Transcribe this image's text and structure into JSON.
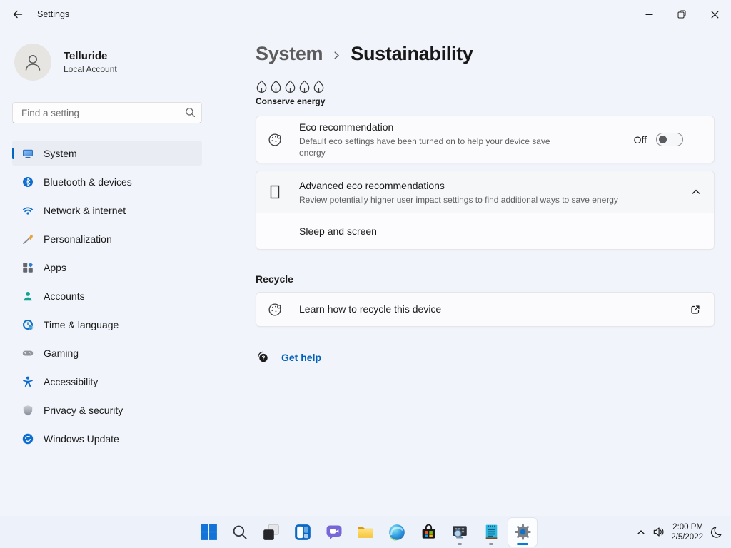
{
  "window": {
    "title": "Settings"
  },
  "sidebar": {
    "user": {
      "name": "Telluride",
      "account_type": "Local Account"
    },
    "search_placeholder": "Find a setting",
    "items": [
      {
        "label": "System",
        "selected": true
      },
      {
        "label": "Bluetooth & devices",
        "selected": false
      },
      {
        "label": "Network & internet",
        "selected": false
      },
      {
        "label": "Personalization",
        "selected": false
      },
      {
        "label": "Apps",
        "selected": false
      },
      {
        "label": "Accounts",
        "selected": false
      },
      {
        "label": "Time & language",
        "selected": false
      },
      {
        "label": "Gaming",
        "selected": false
      },
      {
        "label": "Accessibility",
        "selected": false
      },
      {
        "label": "Privacy & security",
        "selected": false
      },
      {
        "label": "Windows Update",
        "selected": false
      }
    ]
  },
  "main": {
    "breadcrumb": {
      "parent": "System",
      "current": "Sustainability"
    },
    "energy_meter": {
      "label": "Conserve energy",
      "leaf_count": 5
    },
    "eco_recommendation": {
      "title": "Eco recommendation",
      "description": "Default eco settings have been turned on to help your device save energy",
      "toggle_label": "Off",
      "toggle_state": "off"
    },
    "advanced_eco": {
      "title": "Advanced eco recommendations",
      "description": "Review potentially higher user impact settings to find additional ways to save energy",
      "expanded": true,
      "items": [
        {
          "label": "Sleep and screen"
        }
      ]
    },
    "recycle": {
      "section_title": "Recycle",
      "link_label": "Learn how to recycle this device"
    },
    "help": {
      "label": "Get help"
    }
  },
  "taskbar": {
    "icons": [
      "start",
      "search",
      "task-view",
      "widgets",
      "chat",
      "file-explorer",
      "edge",
      "store",
      "screen-viewer-app",
      "notes-app",
      "settings"
    ],
    "active_icon": "settings",
    "running_icons": [
      "screen-viewer-app",
      "notes-app"
    ],
    "tray": {
      "time": "2:00 PM",
      "date": "2/5/2022"
    }
  },
  "colors": {
    "accent": "#0067c0",
    "link": "#005fb8",
    "background": "#f1f4fa",
    "card": "#fbfbfd"
  }
}
